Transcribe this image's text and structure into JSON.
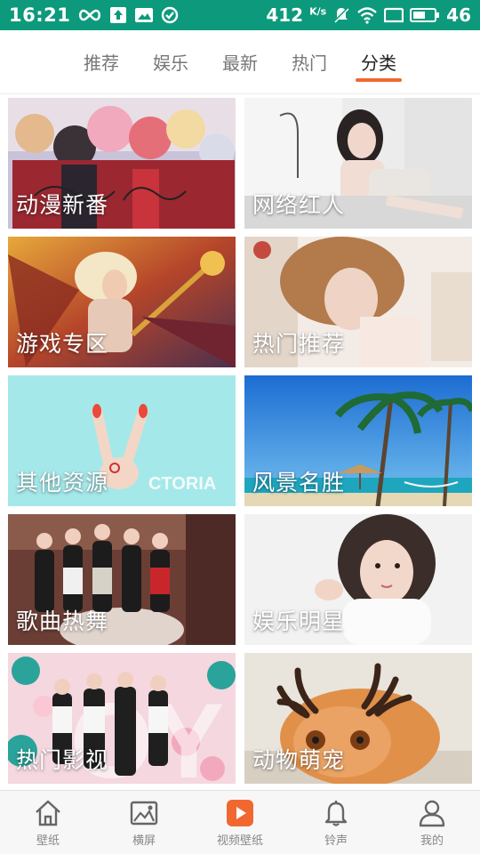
{
  "status_bar": {
    "time": "16:21",
    "speed": "412",
    "speed_unit": "K/s",
    "battery": "46",
    "bg_color": "#0d9a7c"
  },
  "top_tabs": [
    {
      "label": "推荐",
      "active": false
    },
    {
      "label": "娱乐",
      "active": false
    },
    {
      "label": "最新",
      "active": false
    },
    {
      "label": "热门",
      "active": false
    },
    {
      "label": "分类",
      "active": true
    }
  ],
  "accent_color": "#f06830",
  "categories": [
    {
      "label": "动漫新番"
    },
    {
      "label": "网络红人"
    },
    {
      "label": "游戏专区"
    },
    {
      "label": "热门推荐"
    },
    {
      "label": "其他资源"
    },
    {
      "label": "风景名胜"
    },
    {
      "label": "歌曲热舞"
    },
    {
      "label": "娱乐明星"
    },
    {
      "label": "热门影视"
    },
    {
      "label": "动物萌宠"
    }
  ],
  "bottom_nav": [
    {
      "label": "壁纸",
      "icon": "home-icon",
      "active": false
    },
    {
      "label": "横屏",
      "icon": "image-icon",
      "active": false
    },
    {
      "label": "视频壁纸",
      "icon": "play-icon",
      "active": true
    },
    {
      "label": "铃声",
      "icon": "bell-icon",
      "active": false
    },
    {
      "label": "我的",
      "icon": "user-icon",
      "active": false
    }
  ]
}
